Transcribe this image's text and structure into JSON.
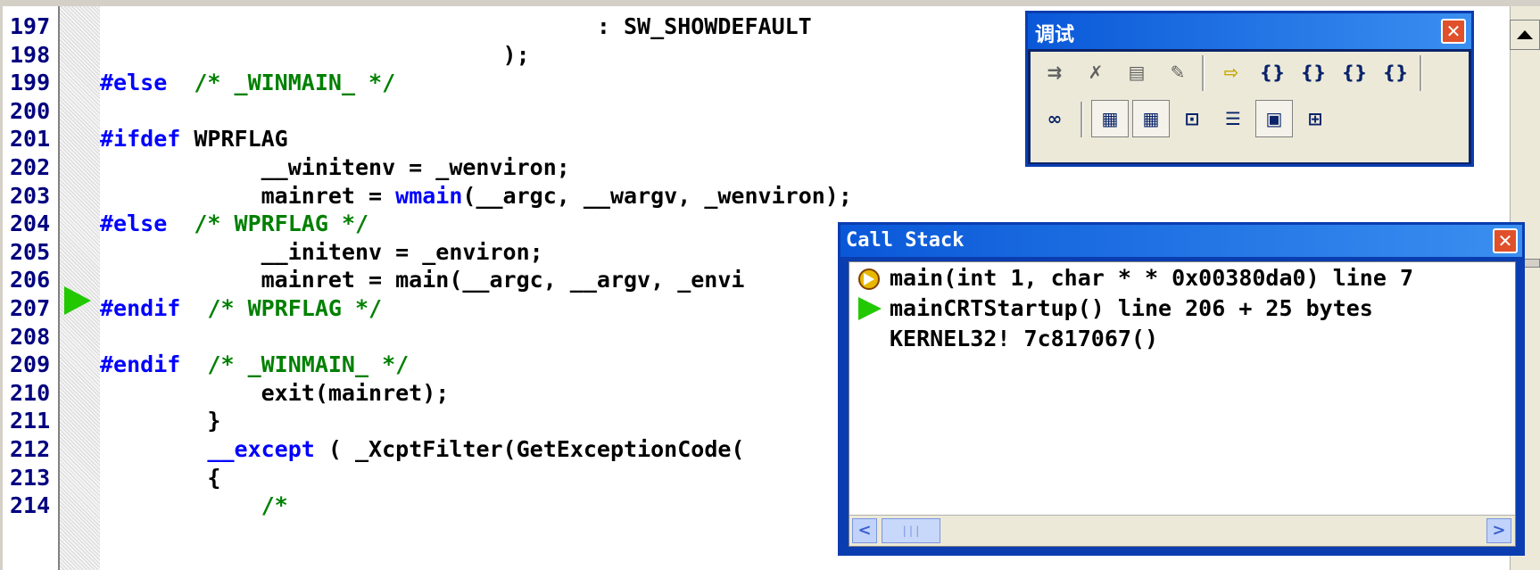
{
  "editor": {
    "line_numbers": [
      "197",
      "198",
      "199",
      "200",
      "201",
      "202",
      "203",
      "204",
      "205",
      "206",
      "207",
      "208",
      "209",
      "210",
      "211",
      "212",
      "213",
      "214"
    ],
    "lines": [
      {
        "parts": [
          {
            "t": "                                     : SW_SHOWDEFAULT",
            "c": "n"
          }
        ]
      },
      {
        "parts": [
          {
            "t": "                              );",
            "c": "n"
          }
        ]
      },
      {
        "parts": [
          {
            "t": "#else",
            "c": "kw"
          },
          {
            "t": "  ",
            "c": "n"
          },
          {
            "t": "/* _WINMAIN_ */",
            "c": "cm"
          }
        ]
      },
      {
        "parts": []
      },
      {
        "parts": [
          {
            "t": "#ifdef",
            "c": "kw"
          },
          {
            "t": " WPRFLAG",
            "c": "n"
          }
        ]
      },
      {
        "parts": [
          {
            "t": "            __winitenv = _wenviron;",
            "c": "n"
          }
        ]
      },
      {
        "parts": [
          {
            "t": "            mainret = ",
            "c": "n"
          },
          {
            "t": "wmain",
            "c": "kw"
          },
          {
            "t": "(__argc, __wargv, _wenviron);",
            "c": "n"
          }
        ]
      },
      {
        "parts": [
          {
            "t": "#else",
            "c": "kw"
          },
          {
            "t": "  ",
            "c": "n"
          },
          {
            "t": "/* WPRFLAG */",
            "c": "cm"
          }
        ]
      },
      {
        "parts": [
          {
            "t": "            __initenv = _environ;",
            "c": "n"
          }
        ]
      },
      {
        "parts": [
          {
            "t": "            mainret = main(__argc, __argv, _envi",
            "c": "n"
          }
        ]
      },
      {
        "parts": [
          {
            "t": "#endif",
            "c": "kw"
          },
          {
            "t": "  ",
            "c": "n"
          },
          {
            "t": "/* WPRFLAG */",
            "c": "cm"
          }
        ]
      },
      {
        "parts": []
      },
      {
        "parts": [
          {
            "t": "#endif",
            "c": "kw"
          },
          {
            "t": "  ",
            "c": "n"
          },
          {
            "t": "/* _WINMAIN_ */",
            "c": "cm"
          }
        ]
      },
      {
        "parts": [
          {
            "t": "            exit(mainret);",
            "c": "n"
          }
        ]
      },
      {
        "parts": [
          {
            "t": "        }",
            "c": "n"
          }
        ]
      },
      {
        "parts": [
          {
            "t": "        ",
            "c": "n"
          },
          {
            "t": "__except",
            "c": "kw"
          },
          {
            "t": " ( _XcptFilter(GetExceptionCode(",
            "c": "n"
          }
        ]
      },
      {
        "parts": [
          {
            "t": "        {",
            "c": "n"
          }
        ]
      },
      {
        "parts": [
          {
            "t": "            ",
            "c": "n"
          },
          {
            "t": "/*",
            "c": "cm"
          }
        ]
      }
    ]
  },
  "debug_toolbar": {
    "title": "调试",
    "close_label": "✕",
    "row1": [
      {
        "name": "restart-icon",
        "glyph": "⇉"
      },
      {
        "name": "stop-debugging-icon",
        "glyph": "✗"
      },
      {
        "name": "break-execution-icon",
        "glyph": "▤"
      },
      {
        "name": "apply-code-changes-icon",
        "glyph": "✎"
      },
      {
        "name": "show-next-statement-icon",
        "glyph": "⇨"
      },
      {
        "name": "step-into-icon",
        "glyph": "{}"
      },
      {
        "name": "step-over-icon",
        "glyph": "{}"
      },
      {
        "name": "step-out-icon",
        "glyph": "{}"
      },
      {
        "name": "run-to-cursor-icon",
        "glyph": "{}"
      }
    ],
    "row2": [
      {
        "name": "quickwatch-icon",
        "glyph": "∞"
      },
      {
        "name": "watch-window-icon",
        "glyph": "▦"
      },
      {
        "name": "variables-window-icon",
        "glyph": "▦"
      },
      {
        "name": "registers-window-icon",
        "glyph": "⊡"
      },
      {
        "name": "memory-window-icon",
        "glyph": "☰"
      },
      {
        "name": "call-stack-window-icon",
        "glyph": "▣"
      },
      {
        "name": "disassembly-window-icon",
        "glyph": "⊞"
      }
    ]
  },
  "call_stack": {
    "title": "Call Stack",
    "close_label": "✕",
    "frames": [
      {
        "text": "main(int 1, char * * 0x00380da0) line 7",
        "marker": "current"
      },
      {
        "text": "mainCRTStartup() line 206 + 25 bytes",
        "marker": "caller"
      },
      {
        "text": "KERNEL32! 7c817067()",
        "marker": "none"
      }
    ],
    "scroll_left": "<",
    "scroll_right": ">",
    "thumb_grip": "|||"
  },
  "colors": {
    "keyword": "#0000ff",
    "comment": "#008000",
    "line_number": "#000080",
    "exec_arrow": "#22c800",
    "titlebar": "#0a58d8"
  }
}
